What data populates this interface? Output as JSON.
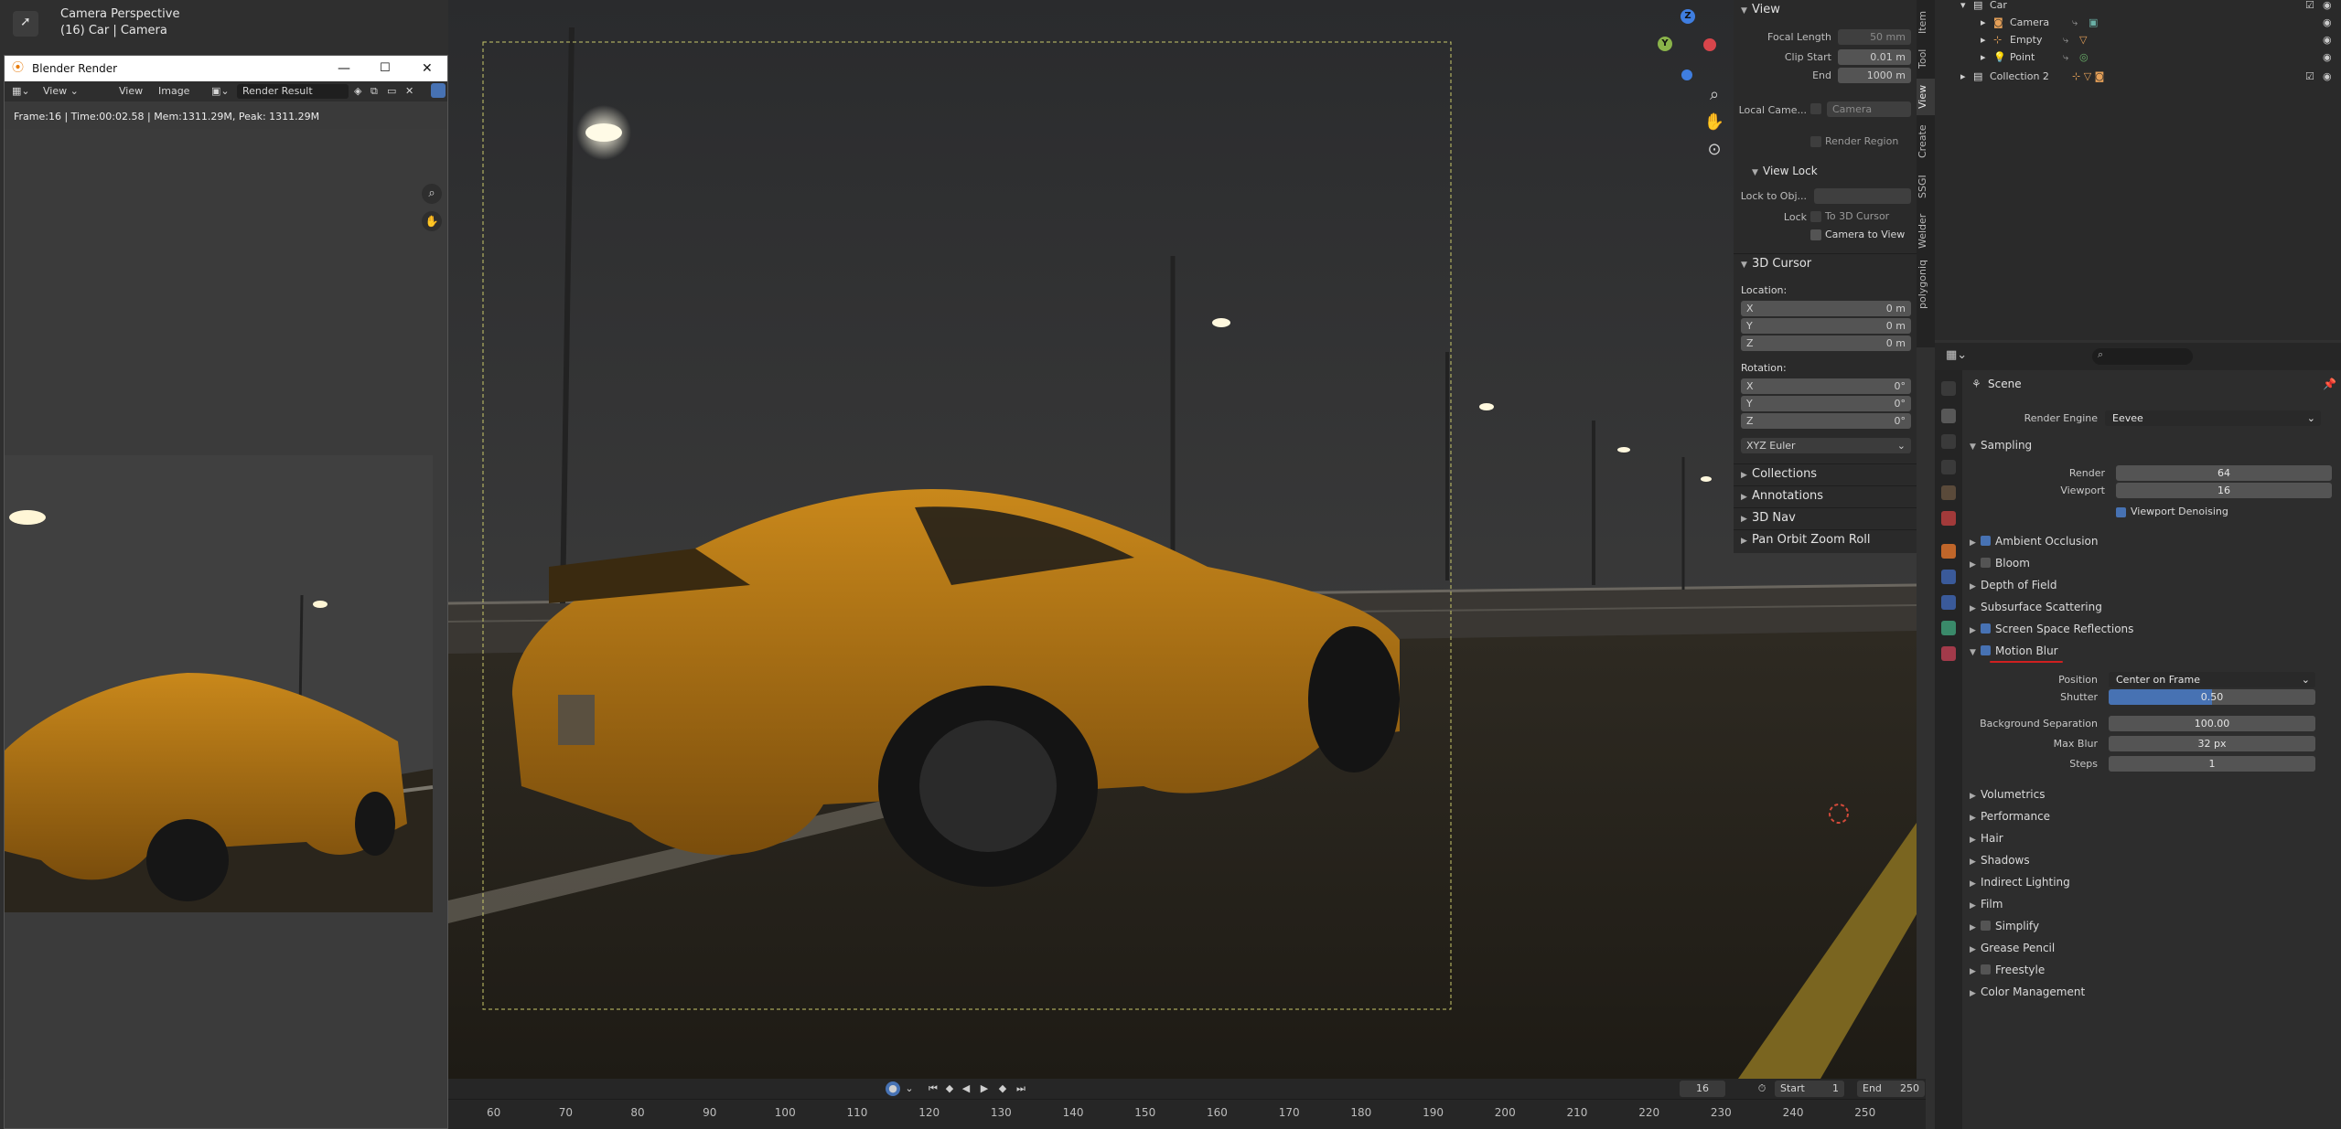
{
  "viewport": {
    "camera_line1": "Camera Perspective",
    "camera_line2": "(16) Car | Camera"
  },
  "npanel": {
    "view_header": "View",
    "focal_length_label": "Focal Length",
    "focal_length_value": "50 mm",
    "clip_start_label": "Clip Start",
    "clip_start_value": "0.01 m",
    "end_label": "End",
    "end_value": "1000 m",
    "local_camera_label": "Local Came...",
    "local_camera_value": "Camera",
    "render_region": "Render Region",
    "view_lock_header": "View Lock",
    "lock_to_obj_label": "Lock to Obj...",
    "lock_label": "Lock",
    "to_3d_cursor": "To 3D Cursor",
    "camera_to_view": "Camera to View",
    "cursor_header": "3D Cursor",
    "location_label": "Location:",
    "loc": [
      {
        "axis": "X",
        "value": "0 m"
      },
      {
        "axis": "Y",
        "value": "0 m"
      },
      {
        "axis": "Z",
        "value": "0 m"
      }
    ],
    "rotation_label": "Rotation:",
    "rot": [
      {
        "axis": "X",
        "value": "0°"
      },
      {
        "axis": "Y",
        "value": "0°"
      },
      {
        "axis": "Z",
        "value": "0°"
      }
    ],
    "rotation_mode": "XYZ Euler",
    "subpanels": [
      "Collections",
      "Annotations",
      "3D Nav",
      "Pan Orbit Zoom Roll"
    ]
  },
  "vtabs": [
    "Item",
    "Tool",
    "View",
    "Create",
    "SSGI",
    "Welder",
    "polygoniq"
  ],
  "timeline": {
    "current_frame": "16",
    "start_label": "Start",
    "start_value": "1",
    "end_label": "End",
    "end_value": "250",
    "ticks": [
      "60",
      "70",
      "80",
      "90",
      "100",
      "110",
      "120",
      "130",
      "140",
      "150",
      "160",
      "170",
      "180",
      "190",
      "200",
      "210",
      "220",
      "230",
      "240",
      "250"
    ]
  },
  "render_window": {
    "title": "Blender Render",
    "menu_view": "View",
    "menu_view2": "View",
    "menu_image": "Image",
    "slot_name": "Render Result",
    "info": "Frame:16 | Time:00:02.58 | Mem:1311.29M, Peak: 1311.29M"
  },
  "outliner": {
    "rows": [
      {
        "name": "Car",
        "indent": 0
      },
      {
        "name": "Camera",
        "indent": 1
      },
      {
        "name": "Empty",
        "indent": 1
      },
      {
        "name": "Point",
        "indent": 1
      },
      {
        "name": "Collection 2",
        "indent": 0
      }
    ]
  },
  "properties": {
    "scene_label": "Scene",
    "render_engine_label": "Render Engine",
    "render_engine_value": "Eevee",
    "sampling_header": "Sampling",
    "render_label": "Render",
    "render_value": "64",
    "viewport_label": "Viewport",
    "viewport_value": "16",
    "viewport_denoising": "Viewport Denoising",
    "sections_top": [
      {
        "label": "Ambient Occlusion",
        "checkbox": true,
        "checked": true
      },
      {
        "label": "Bloom",
        "checkbox": true,
        "checked": false
      },
      {
        "label": "Depth of Field",
        "checkbox": false,
        "checked": false
      },
      {
        "label": "Subsurface Scattering",
        "checkbox": false,
        "checked": false
      },
      {
        "label": "Screen Space Reflections",
        "checkbox": true,
        "checked": true
      }
    ],
    "motion_blur_label": "Motion Blur",
    "position_label": "Position",
    "position_value": "Center on Frame",
    "shutter_label": "Shutter",
    "shutter_value": "0.50",
    "shutter_fraction": 0.5,
    "bg_sep_label": "Background Separation",
    "bg_sep_value": "100.00",
    "max_blur_label": "Max Blur",
    "max_blur_value": "32 px",
    "steps_label": "Steps",
    "steps_value": "1",
    "sections_bottom": [
      {
        "label": "Volumetrics",
        "checkbox": false
      },
      {
        "label": "Performance",
        "checkbox": false
      },
      {
        "label": "Hair",
        "checkbox": false
      },
      {
        "label": "Shadows",
        "checkbox": false
      },
      {
        "label": "Indirect Lighting",
        "checkbox": false
      },
      {
        "label": "Film",
        "checkbox": false
      },
      {
        "label": "Simplify",
        "checkbox": true
      },
      {
        "label": "Grease Pencil",
        "checkbox": false
      },
      {
        "label": "Freestyle",
        "checkbox": true
      },
      {
        "label": "Color Management",
        "checkbox": false
      }
    ]
  },
  "colors": {
    "accent": "#4772b3",
    "car_orange": "#c78a1a"
  }
}
